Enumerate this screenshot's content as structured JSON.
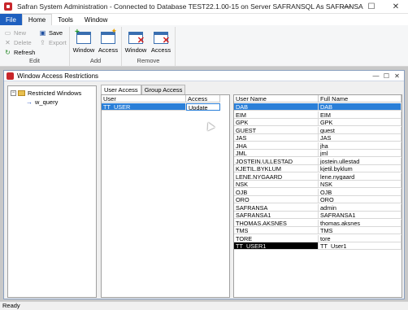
{
  "window": {
    "title": "Safran System Administration - Connected to Database TEST22.1.00-15 on Server SAFRANSQL As SAFRANSA",
    "minimize": "—",
    "maximize": "☐",
    "close": "✕"
  },
  "menu": {
    "file": "File",
    "home": "Home",
    "tools": "Tools",
    "window": "Window"
  },
  "ribbon": {
    "edit_group": {
      "label": "Edit",
      "new": "New",
      "delete": "Delete",
      "refresh": "Refresh",
      "save": "Save",
      "export": "Export"
    },
    "add_group": {
      "label": "Add",
      "window": "Window",
      "access": "Access"
    },
    "remove_group": {
      "label": "Remove",
      "window": "Window",
      "access": "Access"
    }
  },
  "inner_window": {
    "title": "Window Access Restrictions",
    "minimize": "—",
    "maximize": "☐",
    "close": "✕"
  },
  "tree": {
    "root_expander": "−",
    "root": "Restricted Windows",
    "child": "w_query"
  },
  "tabs": {
    "user_access": "User Access",
    "group_access": "Group Access"
  },
  "access_grid": {
    "headers": [
      "User",
      "Access"
    ],
    "rows": [
      {
        "user": "TT_USER",
        "access": "Update"
      }
    ]
  },
  "users_grid": {
    "headers": [
      "User Name",
      "Full Name"
    ],
    "rows": [
      {
        "user": "DAB",
        "full": "DAB"
      },
      {
        "user": "EIM",
        "full": "EIM"
      },
      {
        "user": "GPK",
        "full": "GPK"
      },
      {
        "user": "GUEST",
        "full": "guest"
      },
      {
        "user": "JAS",
        "full": "JAS"
      },
      {
        "user": "JHA",
        "full": "jha"
      },
      {
        "user": "JML",
        "full": "jml"
      },
      {
        "user": "JOSTEIN.ULLESTAD",
        "full": "jostein.ullestad"
      },
      {
        "user": "KJETIL.BYKLUM",
        "full": "kjetil.byklum"
      },
      {
        "user": "LENE.NYGAARD",
        "full": "lene.nygaard"
      },
      {
        "user": "NSK",
        "full": "NSK"
      },
      {
        "user": "OJB",
        "full": "OJB"
      },
      {
        "user": "ORO",
        "full": "ORO"
      },
      {
        "user": "SAFRANSA",
        "full": "admin"
      },
      {
        "user": "SAFRANSA1",
        "full": "SAFRANSA1"
      },
      {
        "user": "THOMAS.AKSNES",
        "full": "thomas.aksnes"
      },
      {
        "user": "TMS",
        "full": "TMS"
      },
      {
        "user": "TORE",
        "full": "tore"
      },
      {
        "user": "TT_USER1",
        "full": "TT_User1"
      }
    ]
  },
  "status": "Ready",
  "colors": {
    "selection": "#2a7fd8",
    "file_tab": "#1e5fbf",
    "brand_red": "#c8262b"
  }
}
